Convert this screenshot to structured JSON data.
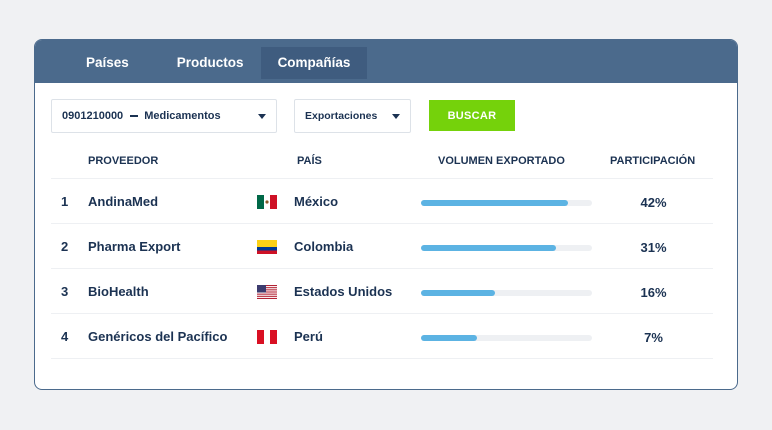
{
  "tabs": [
    {
      "label": "Países",
      "active": false
    },
    {
      "label": "Productos",
      "active": false
    },
    {
      "label": "Compañías",
      "active": true
    }
  ],
  "filters": {
    "product_code": "0901210000",
    "product_name": "Medicamentos",
    "flow": "Exportaciones",
    "search_label": "BUSCAR"
  },
  "table": {
    "headers": {
      "provider": "PROVEEDOR",
      "country": "PAÍS",
      "volume": "VOLUMEN EXPORTADO",
      "share": "PARTICIPACIÓN"
    },
    "rows": [
      {
        "rank": "1",
        "provider": "AndinaMed",
        "flag": "mexico-flag-icon",
        "country": "México",
        "volume_fraction": 0.86,
        "share": "42%"
      },
      {
        "rank": "2",
        "provider": "Pharma Export",
        "flag": "colombia-flag-icon",
        "country": "Colombia",
        "volume_fraction": 0.79,
        "share": "31%"
      },
      {
        "rank": "3",
        "provider": "BioHealth",
        "flag": "usa-flag-icon",
        "country": "Estados Unidos",
        "volume_fraction": 0.43,
        "share": "16%"
      },
      {
        "rank": "4",
        "provider": "Genéricos del Pacífico",
        "flag": "peru-flag-icon",
        "country": "Perú",
        "volume_fraction": 0.33,
        "share": "7%"
      }
    ]
  },
  "colors": {
    "header_bg": "#4b6a8c",
    "active_tab_bg": "#3f5c7f",
    "button_green": "#75d20b",
    "bar_fill": "#5cb3e3",
    "text_dark": "#1b3252"
  }
}
